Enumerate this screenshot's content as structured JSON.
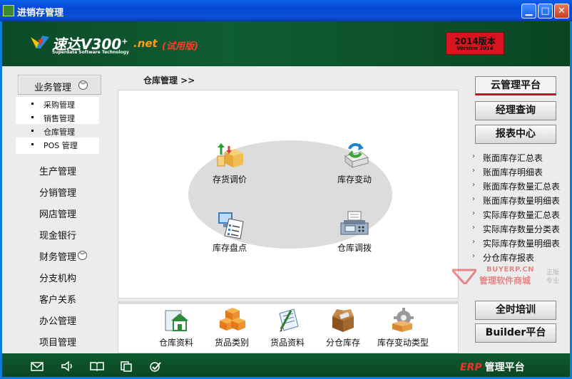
{
  "window": {
    "title": "进销存管理"
  },
  "header": {
    "brand_name": "速达V300",
    "brand_plus": "+",
    "brand_suffix": ".net",
    "trial_label": "(试用版)",
    "brand_sub": "Superdata Software Technology",
    "version_main": "2014版本",
    "version_sub": "Version 2014"
  },
  "leftnav": {
    "business_label": "业务管理",
    "submenu": [
      {
        "label": "采购管理",
        "active": false
      },
      {
        "label": "销售管理",
        "active": false
      },
      {
        "label": "仓库管理",
        "active": true
      },
      {
        "label": "POS 管理",
        "active": false
      }
    ],
    "items": [
      "生产管理",
      "分销管理",
      "网店管理",
      "现金银行"
    ],
    "finance_label": "财务管理",
    "items2": [
      "分支机构",
      "客户关系",
      "办公管理",
      "项目管理"
    ]
  },
  "breadcrumb": "仓库管理 >>",
  "functions": [
    {
      "label": "存货调价",
      "icon": "price-adjust-icon"
    },
    {
      "label": "库存变动",
      "icon": "stock-change-icon"
    },
    {
      "label": "库存盘点",
      "icon": "stock-count-icon"
    },
    {
      "label": "仓库调拨",
      "icon": "warehouse-transfer-icon"
    }
  ],
  "toolbar": [
    {
      "label": "仓库资料",
      "icon": "warehouse-info-icon"
    },
    {
      "label": "货品类别",
      "icon": "goods-category-icon"
    },
    {
      "label": "货品资料",
      "icon": "goods-info-icon"
    },
    {
      "label": "分仓库存",
      "icon": "branch-stock-icon"
    },
    {
      "label": "库存变动类型",
      "icon": "change-type-icon"
    }
  ],
  "right": {
    "cloud_button": "云管理平台",
    "manager_button": "经理查询",
    "report_button": "报表中心",
    "links": [
      "账面库存汇总表",
      "账面库存明细表",
      "账面库存数量汇总表",
      "账面库存数量明细表",
      "实际库存数量汇总表",
      "实际库存数量分类表",
      "实际库存数量明细表",
      "分仓库存报表"
    ],
    "watermark_site": "BUYERP.CN",
    "watermark_name": "管理软件商城",
    "watermark_tag": "正版 专业",
    "training_button": "全时培训",
    "builder_button": "Builder平台"
  },
  "footer": {
    "erp": "ERP",
    "platform": "管理平台",
    "icons": [
      "mail-icon",
      "speaker-icon",
      "book-icon",
      "copy-icon",
      "check-icon"
    ]
  },
  "colors": {
    "title_blue": "#0548d6",
    "brand_green": "#0f5d33",
    "accent_red": "#c8102e",
    "badge_red": "#d9141e"
  }
}
